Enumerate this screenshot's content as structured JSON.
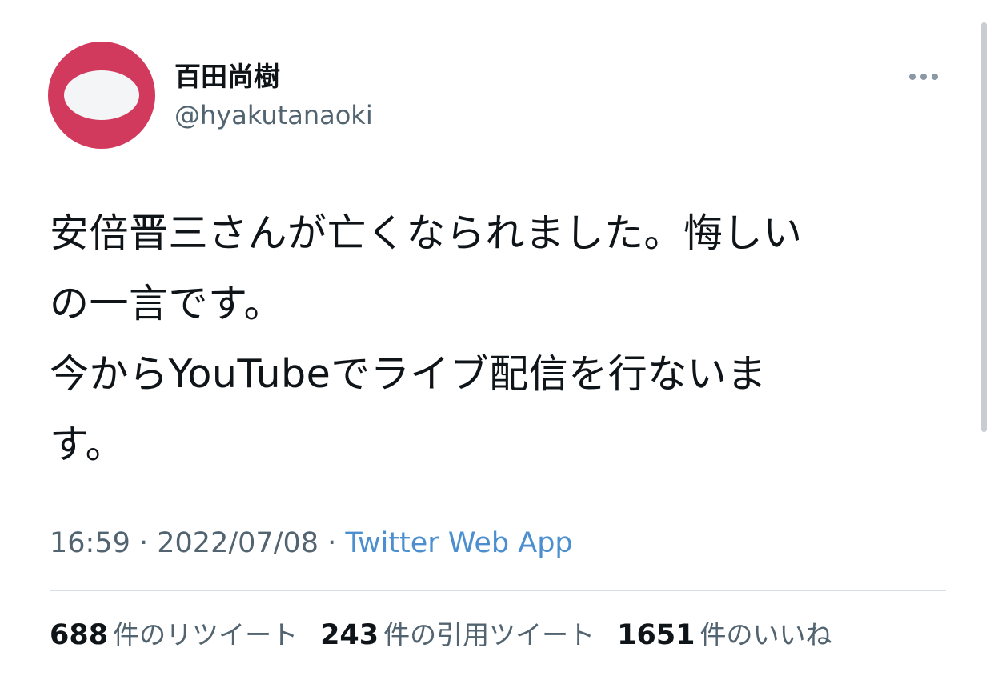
{
  "author": {
    "display_name": "百田尚樹",
    "handle": "@hyakutanaoki",
    "avatar_colors": {
      "outer": "#d13a5c",
      "inner": "#f4f5f7"
    }
  },
  "menu_icon": "more-horizontal-icon",
  "tweet": {
    "text": "安倍晋三さんが亡くなられました。悔しい\nの一言です。\n今からYouTubeでライブ配信を行ないま\nす。"
  },
  "meta": {
    "time": "16:59",
    "separator": " · ",
    "date": "2022/07/08",
    "source": "Twitter Web App"
  },
  "stats": [
    {
      "count": "688",
      "label": "件のリツイート"
    },
    {
      "count": "243",
      "label": "件の引用ツイート"
    },
    {
      "count": "1651",
      "label": "件のいいね"
    }
  ],
  "colors": {
    "text": "#0f1419",
    "secondary": "#536471",
    "link": "#4b8fd0",
    "divider": "#d9dee3"
  }
}
